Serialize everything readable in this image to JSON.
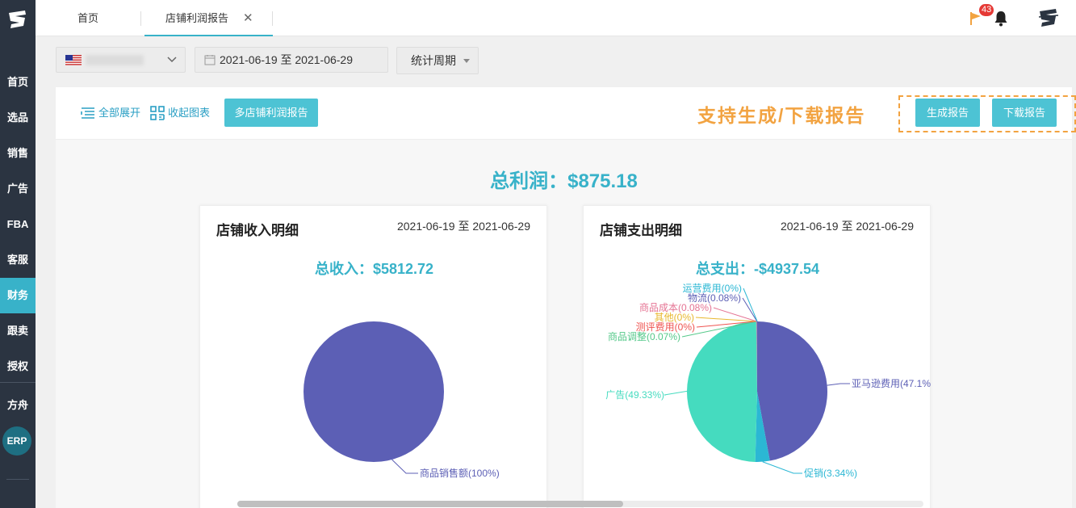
{
  "sidebar": {
    "items": [
      "首页",
      "选品",
      "销售",
      "广告",
      "FBA",
      "客服",
      "财务",
      "跟卖",
      "授权",
      "方舟"
    ],
    "active": "财务",
    "erp": "ERP"
  },
  "tabs": {
    "home": "首页",
    "active": "店铺利润报告"
  },
  "notifications": {
    "count": "43"
  },
  "filters": {
    "date_range": "2021-06-19 至 2021-06-29",
    "period": "统计周期"
  },
  "toolbar": {
    "expand_all": "全部展开",
    "collapse_chart": "收起图表",
    "multi_store_report": "多店铺利润报告",
    "promo": "支持生成/下载报告",
    "generate_report": "生成报告",
    "download_report": "下载报告"
  },
  "summary": {
    "total_profit": "总利润：$875.18"
  },
  "income": {
    "title": "店铺收入明细",
    "date_range": "2021-06-19 至 2021-06-29",
    "total": "总收入：$5812.72"
  },
  "expense": {
    "title": "店铺支出明细",
    "date_range": "2021-06-19 至 2021-06-29",
    "total": "总支出：-$4937.54"
  },
  "colors": {
    "accent": "#38b2c9",
    "sidebar": "#2b3441",
    "promo": "#f2a341",
    "purple": "#5c5fb5",
    "teal": "#45dbbf",
    "blue": "#2bb7d4"
  },
  "chart_data": [
    {
      "type": "pie",
      "slices": [
        {
          "label": "商品销售额(100%)",
          "value": 100,
          "color": "#5c5fb5"
        }
      ]
    },
    {
      "type": "pie",
      "slices": [
        {
          "label": "亚马逊费用(47.1%",
          "value": 47.1,
          "color": "#5c5fb5"
        },
        {
          "label": "促销(3.34%)",
          "value": 3.34,
          "color": "#2bb7d4"
        },
        {
          "label": "广告(49.33%)",
          "value": 49.33,
          "color": "#45dbbf"
        },
        {
          "label": "商品调整(0.07%)",
          "value": 0.07,
          "color": "#55c98a"
        },
        {
          "label": "测评费用(0%)",
          "value": 0,
          "color": "#ef5350"
        },
        {
          "label": "其他(0%)",
          "value": 0,
          "color": "#e8b82e"
        },
        {
          "label": "商品成本(0.08%)",
          "value": 0.08,
          "color": "#e57393"
        },
        {
          "label": "物流(0.08%)",
          "value": 0.08,
          "color": "#5c5fb5"
        },
        {
          "label": "运营费用(0%)",
          "value": 0,
          "color": "#2bb7d4"
        }
      ]
    }
  ]
}
